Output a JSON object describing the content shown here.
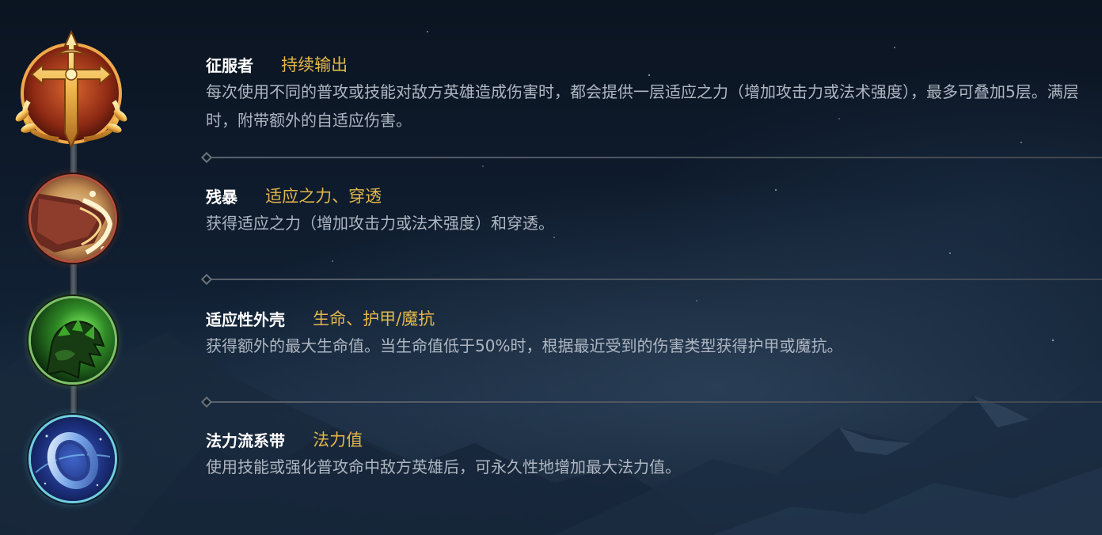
{
  "runes": [
    {
      "name": "征服者",
      "tag": "持续输出",
      "description": "每次使用不同的普攻或技能对敌方英雄造成伤害时，都会提供一层适应之力（增加攻击力或法术强度），最多可叠加5层。满层时，附带额外的自适应伤害。",
      "icon": "conqueror-icon"
    },
    {
      "name": "残暴",
      "tag": "适应之力、穿透",
      "description": "获得适应之力（增加攻击力或法术强度）和穿透。",
      "icon": "brutal-claw-icon"
    },
    {
      "name": "适应性外壳",
      "tag": "生命、护甲/魔抗",
      "description": "获得额外的最大生命值。当生命值低于50%时，根据最近受到的伤害类型获得护甲或魔抗。",
      "icon": "adaptive-shell-icon"
    },
    {
      "name": "法力流系带",
      "tag": "法力值",
      "description": "使用技能或强化普攻命中敌方英雄后，可永久性地增加最大法力值。",
      "icon": "mana-band-icon"
    }
  ],
  "colors": {
    "name": "#ffffff",
    "tag": "#e4b74a",
    "description": "#aeb6c1",
    "background": "#0f1d2f"
  }
}
